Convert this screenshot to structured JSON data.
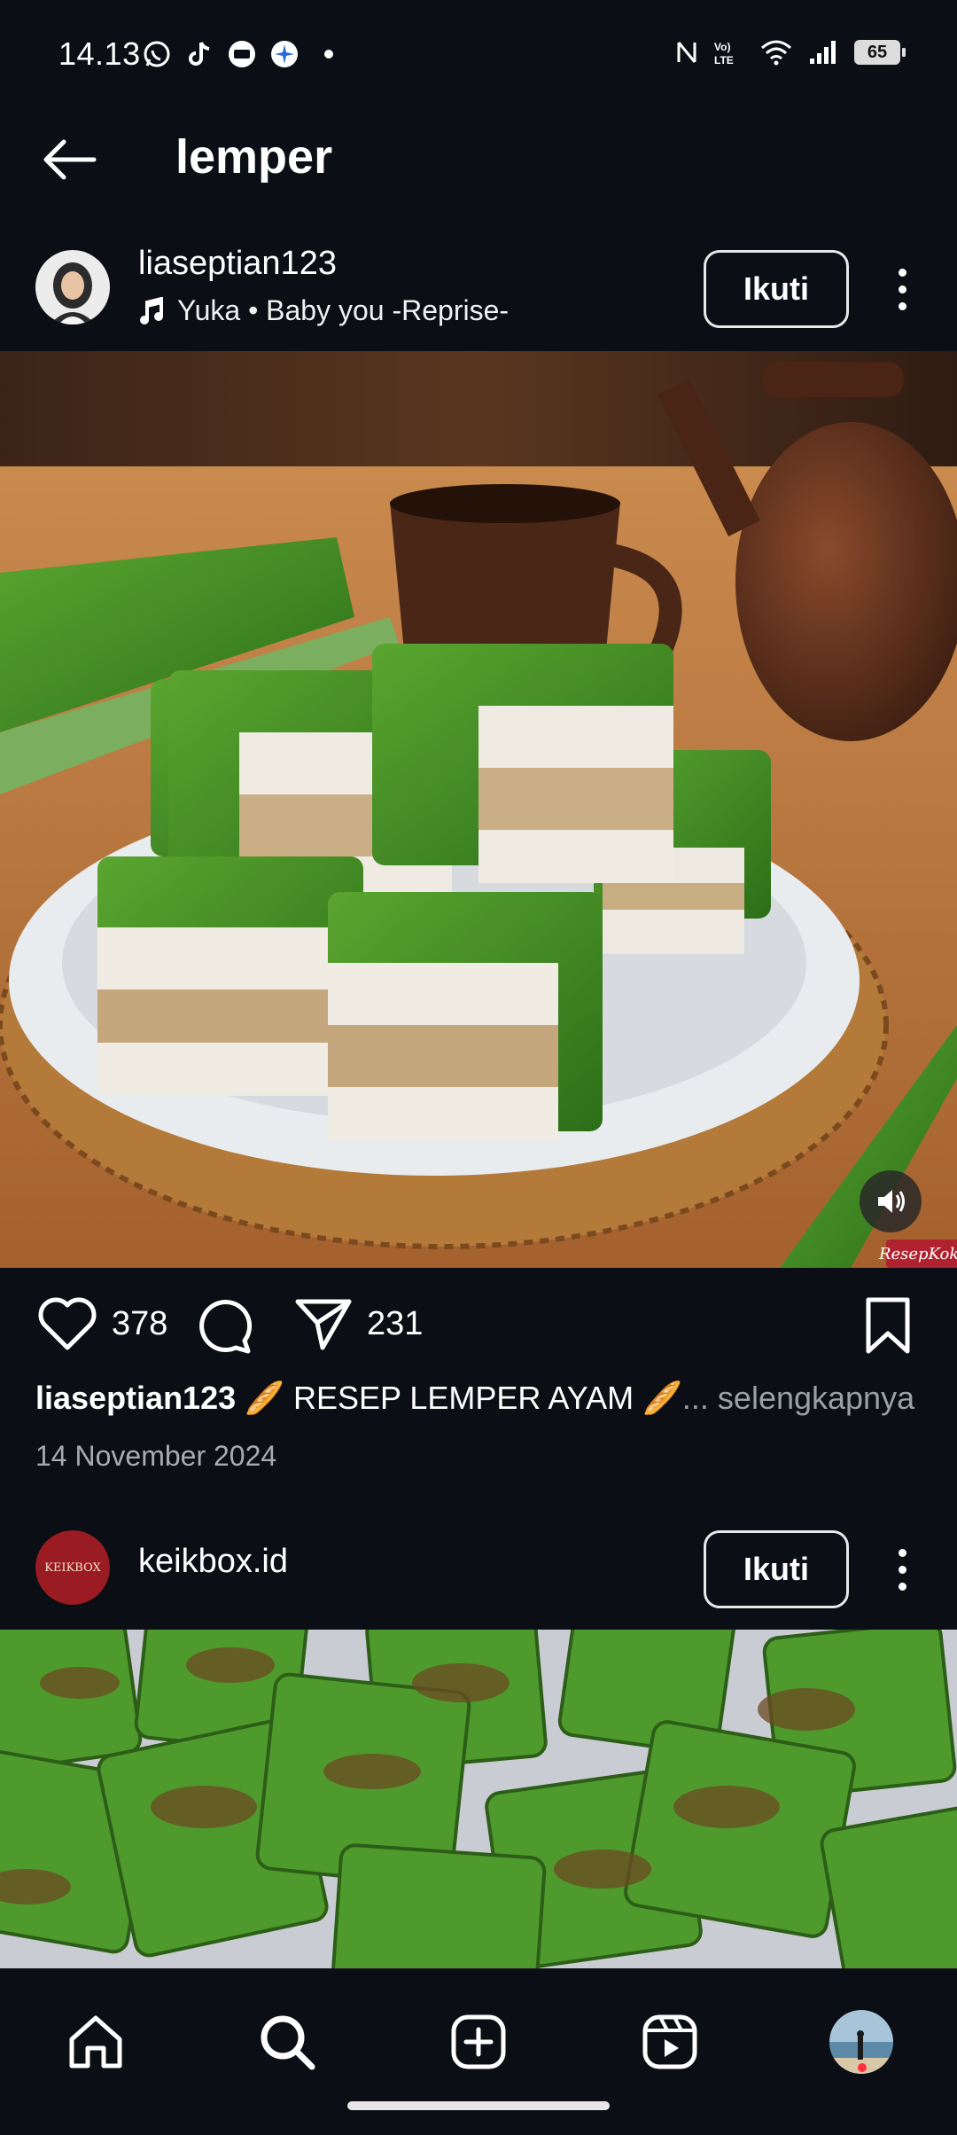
{
  "status_bar": {
    "time": "14.13",
    "battery": "65",
    "icons_left": [
      "whatsapp-icon",
      "tiktok-icon",
      "message-app-icon",
      "browser-app-icon"
    ],
    "icons_right": [
      "nfc-icon",
      "volte-icon",
      "wifi-icon",
      "signal-icon",
      "battery-icon"
    ]
  },
  "header": {
    "title": "lemper"
  },
  "posts": [
    {
      "username": "liaseptian123",
      "music": "Yuka • Baby you -Reprise-",
      "follow_label": "Ikuti",
      "likes": "378",
      "shares": "231",
      "caption_user": "liaseptian123",
      "caption_text": " 🥖 RESEP LEMPER AYAM 🥖",
      "caption_more": "... selengkapnya",
      "date": "14 November 2024",
      "watermark": "ResepKoki"
    },
    {
      "username": "keikbox.id",
      "follow_label": "Ikuti",
      "avatar_text": "KEIKBOX"
    }
  ],
  "bottom_nav": [
    "home-icon",
    "search-icon",
    "create-icon",
    "reels-icon",
    "profile-avatar"
  ],
  "colors": {
    "background": "#0b0e14",
    "text": "#ffffff",
    "muted": "#a8abb0",
    "notification": "#ff3040"
  }
}
